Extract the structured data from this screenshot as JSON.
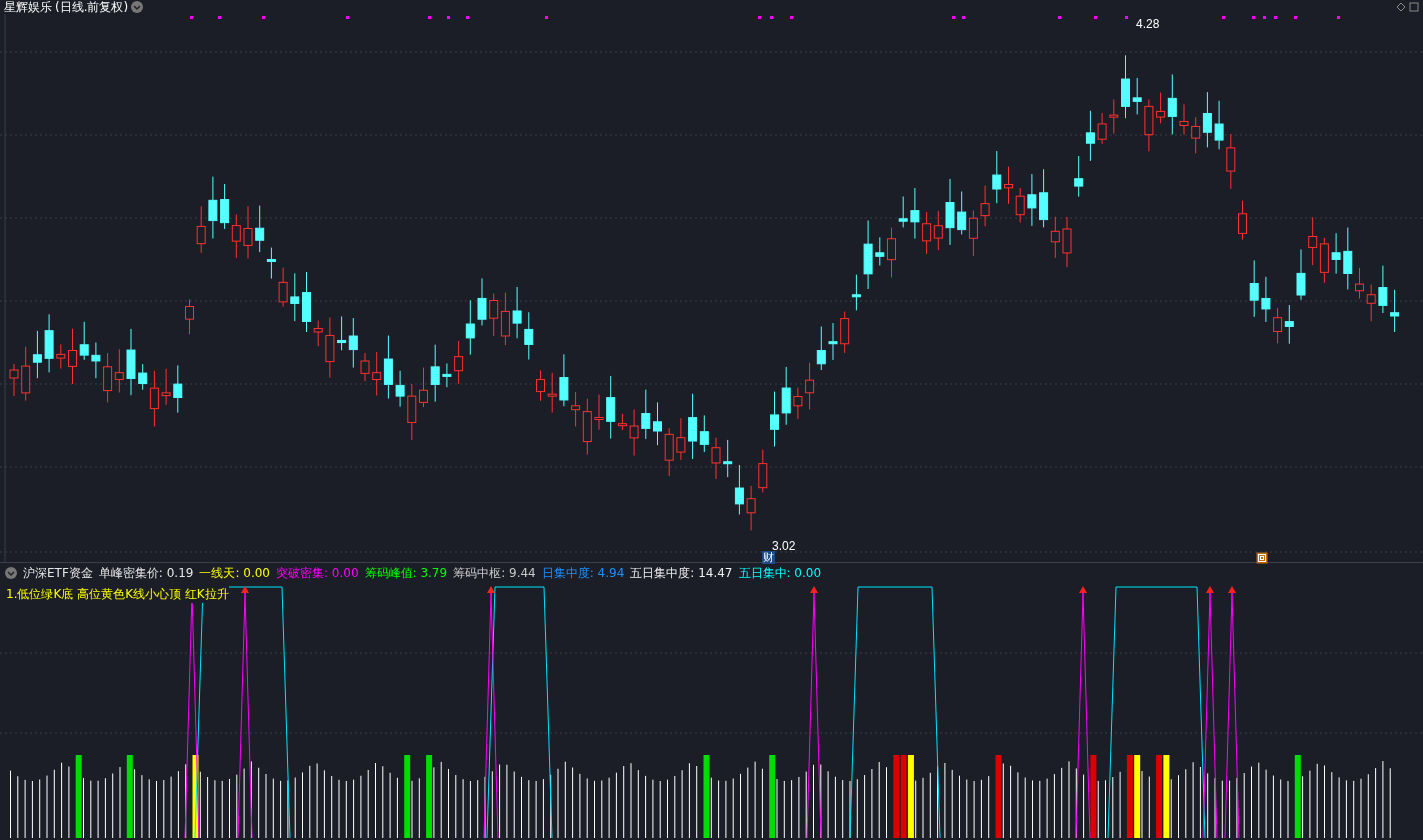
{
  "title": "星辉娱乐",
  "period": "(日线.前复权)",
  "price_high": "4.28",
  "price_low": "3.02",
  "event_marker": "财",
  "indicator": {
    "name": "沪深ETF资金",
    "legend": [
      {
        "label": "单峰密集价: 0.19",
        "color": "#e6e6e6"
      },
      {
        "label": "一线天: 0.00",
        "color": "#ffff00"
      },
      {
        "label": "突破密集: 0.00",
        "color": "#ff00ff"
      },
      {
        "label": "筹码峰值: 3.79",
        "color": "#00ff00"
      },
      {
        "label": "筹码中枢: 9.44",
        "color": "#c8c8c8"
      },
      {
        "label": "日集中度: 4.94",
        "color": "#1e90ff"
      },
      {
        "label": "五日集中度: 14.47",
        "color": "#f0f0f0"
      },
      {
        "label": "五日集中: 0.00",
        "color": "#00ffff"
      }
    ],
    "note": "1.低位绿K底 高位黄色K线小心顶 红K拉升"
  }
}
